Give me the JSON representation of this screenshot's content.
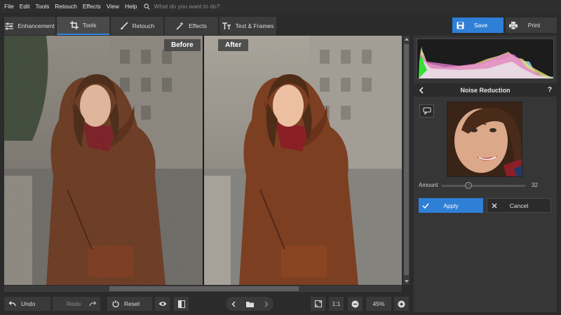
{
  "menu": {
    "items": [
      "File",
      "Edit",
      "Tools",
      "Retouch",
      "Effects",
      "View",
      "Help"
    ],
    "search_placeholder": "What do you want to do?"
  },
  "tabs": [
    {
      "label": "Enhancement",
      "icon": "sliders-icon",
      "active": false
    },
    {
      "label": "Tools",
      "icon": "crop-icon",
      "active": true
    },
    {
      "label": "Retouch",
      "icon": "brush-icon",
      "active": false
    },
    {
      "label": "Effects",
      "icon": "magic-wand-icon",
      "active": false
    },
    {
      "label": "Text & Frames",
      "icon": "text-icon",
      "active": false
    }
  ],
  "actions": {
    "save_label": "Save",
    "print_label": "Print"
  },
  "canvas": {
    "before_label": "Before",
    "after_label": "After"
  },
  "panel": {
    "title": "Noise Reduction",
    "help": "?",
    "amount_label": "Amount",
    "amount_value": "32",
    "amount_fraction": 0.32,
    "apply_label": "Apply",
    "cancel_label": "Cancel"
  },
  "bottom": {
    "undo_label": "Undo",
    "redo_label": "Redo",
    "reset_label": "Reset",
    "one_to_one": "1:1",
    "zoom": "45%"
  },
  "colors": {
    "accent": "#2f7fd6",
    "panel_bg": "#363636",
    "app_bg": "#2b2b2b"
  }
}
